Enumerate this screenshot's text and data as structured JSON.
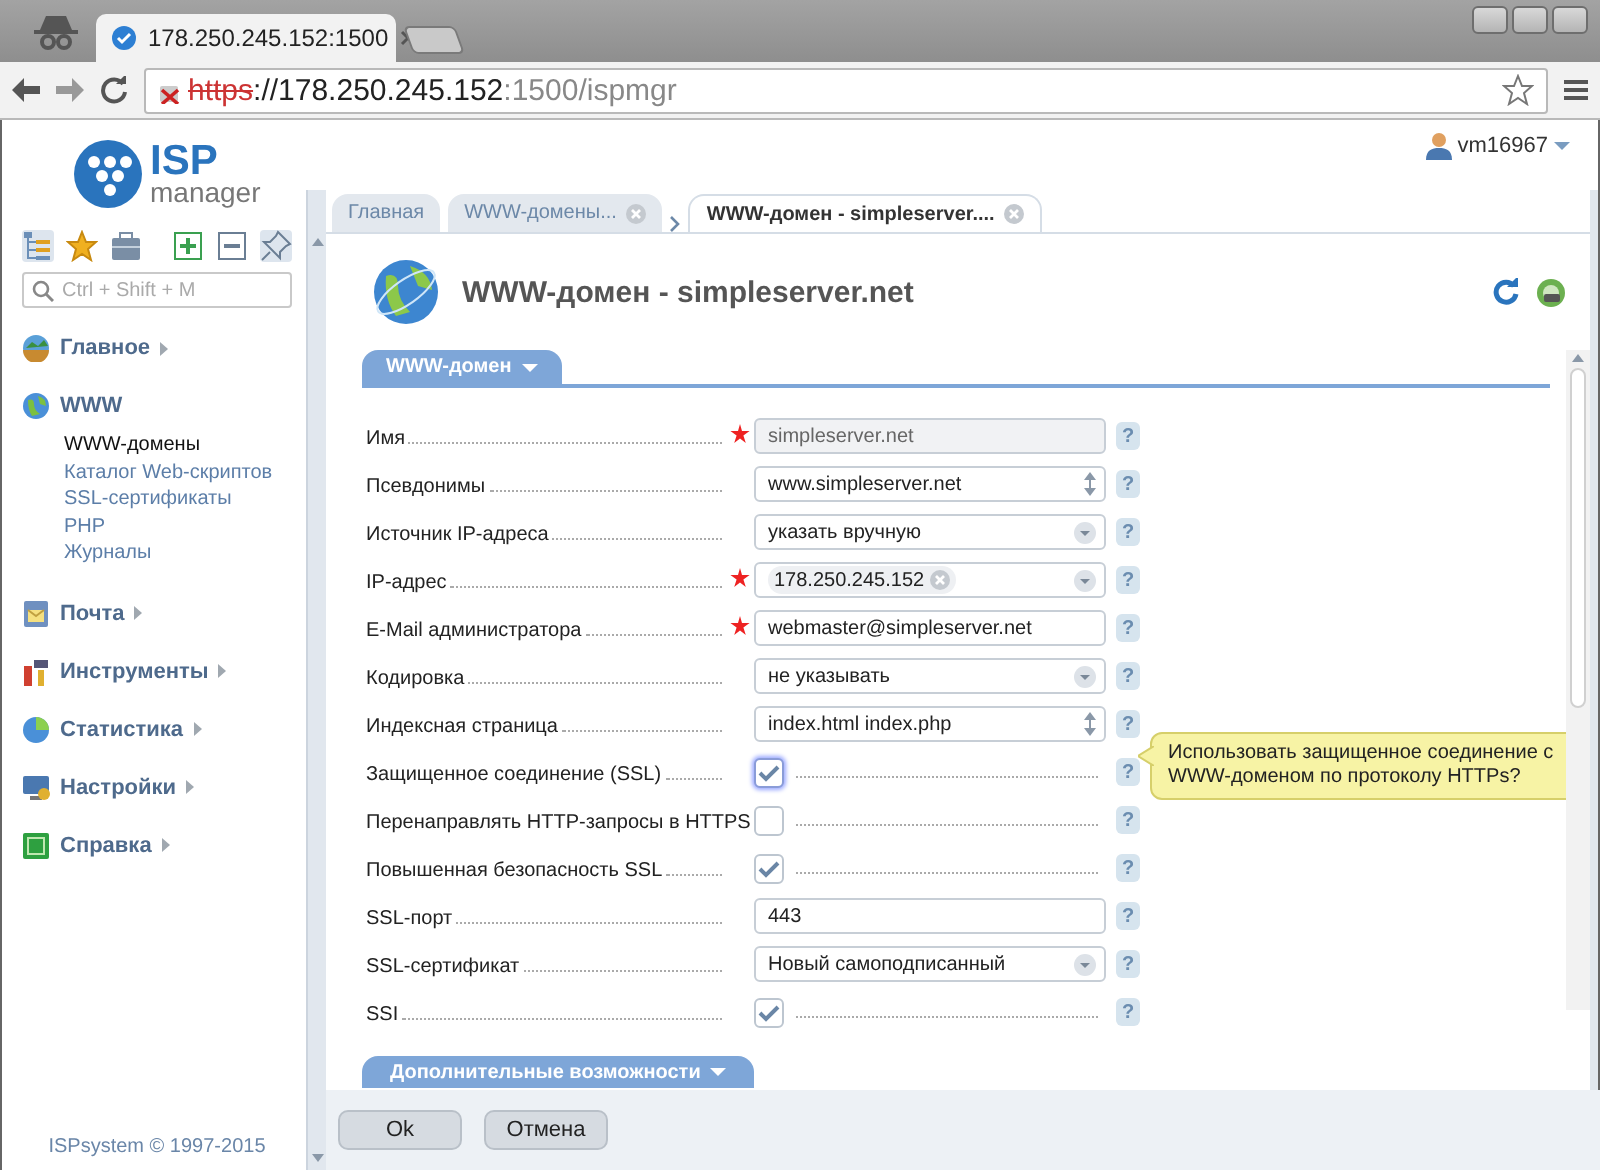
{
  "browser": {
    "tab_title": "178.250.245.152:1500",
    "address": [
      {
        "kind": "insecure-scheme",
        "text": "https"
      },
      {
        "kind": "host",
        "text": "://178.250.245.152"
      },
      {
        "kind": "path",
        "text": ":1500/ispmgr"
      }
    ]
  },
  "header": {
    "logo": {
      "word": "ISP",
      "sub": "manager"
    },
    "user": "vm16967"
  },
  "sidebar": {
    "toolbar": [
      {
        "kind": "tree",
        "selected": true
      },
      {
        "kind": "star",
        "selected": false
      },
      {
        "kind": "briefcase",
        "selected": false
      },
      {
        "kind": "expand",
        "selected": false
      },
      {
        "kind": "collapse",
        "selected": false
      },
      {
        "kind": "pin",
        "selected": true
      }
    ],
    "search": {
      "placeholder": "Ctrl + Shift + M"
    },
    "groups": [
      {
        "label": "Главное",
        "expanded": false
      },
      {
        "label": "WWW",
        "expanded": true,
        "children": [
          {
            "label": "WWW-домены",
            "selected": true
          },
          {
            "label": "Каталог Web-скриптов",
            "selected": false
          },
          {
            "label": "SSL-сертификаты",
            "selected": false
          },
          {
            "label": "PHP",
            "selected": false
          },
          {
            "label": "Журналы",
            "selected": false
          }
        ]
      },
      {
        "label": "Почта",
        "expanded": false
      },
      {
        "label": "Инструменты",
        "expanded": false
      },
      {
        "label": "Статистика",
        "expanded": false
      },
      {
        "label": "Настройки",
        "expanded": false
      },
      {
        "label": "Справка",
        "expanded": false
      }
    ],
    "footer": "ISPsystem © 1997-2015"
  },
  "tabs": [
    {
      "label": "Главная",
      "selected": false,
      "closable": false
    },
    {
      "label": "WWW-домены...",
      "selected": false,
      "closable": true
    },
    {
      "label": "WWW-домен - simpleserver....",
      "selected": true,
      "closable": true
    }
  ],
  "form": {
    "title": "WWW-домен - simpleserver.net",
    "section": "WWW-домен",
    "fields": [
      {
        "label": "Имя",
        "kind": "text",
        "required": true,
        "disabled": true,
        "value": "simpleserver.net",
        "help": "?"
      },
      {
        "label": "Псевдонимы",
        "kind": "multiline",
        "required": false,
        "value": "www.simpleserver.net",
        "help": "?"
      },
      {
        "label": "Источник IP-адреса",
        "kind": "select",
        "required": false,
        "value": "указать вручную",
        "help": "?"
      },
      {
        "label": "IP-адрес",
        "kind": "tags",
        "required": true,
        "tags": [
          "178.250.245.152"
        ],
        "help": "?"
      },
      {
        "label": "E-Mail администратора",
        "kind": "text",
        "required": true,
        "disabled": false,
        "value": "webmaster@simpleserver.net",
        "help": "?"
      },
      {
        "label": "Кодировка",
        "kind": "select",
        "required": false,
        "value": "не указывать",
        "help": "?"
      },
      {
        "label": "Индексная страница",
        "kind": "multiline",
        "required": false,
        "value": "index.html index.php",
        "help": "?"
      },
      {
        "label": "Защищенное соединение (SSL)",
        "kind": "checkbox",
        "required": false,
        "checked": true,
        "focused": true,
        "help": "?",
        "tooltip": "Использовать защищенное соединение с WWW-доменом по протоколу HTTPs?"
      },
      {
        "label": "Перенаправлять HTTP-запросы в HTTPS",
        "kind": "checkbox",
        "required": false,
        "checked": false,
        "focused": false,
        "help": "?"
      },
      {
        "label": "Повышенная безопасность SSL",
        "kind": "checkbox",
        "required": false,
        "checked": true,
        "focused": false,
        "help": "?"
      },
      {
        "label": "SSL-порт",
        "kind": "text",
        "required": false,
        "disabled": false,
        "value": "443",
        "help": "?"
      },
      {
        "label": "SSL-сертификат",
        "kind": "select",
        "required": false,
        "value": "Новый самоподписанный",
        "help": "?"
      },
      {
        "label": "SSI",
        "kind": "checkbox",
        "required": false,
        "checked": true,
        "focused": false,
        "help": "?"
      }
    ],
    "more": "Дополнительные возможности",
    "buttons": [
      "Ok",
      "Отмена"
    ]
  }
}
